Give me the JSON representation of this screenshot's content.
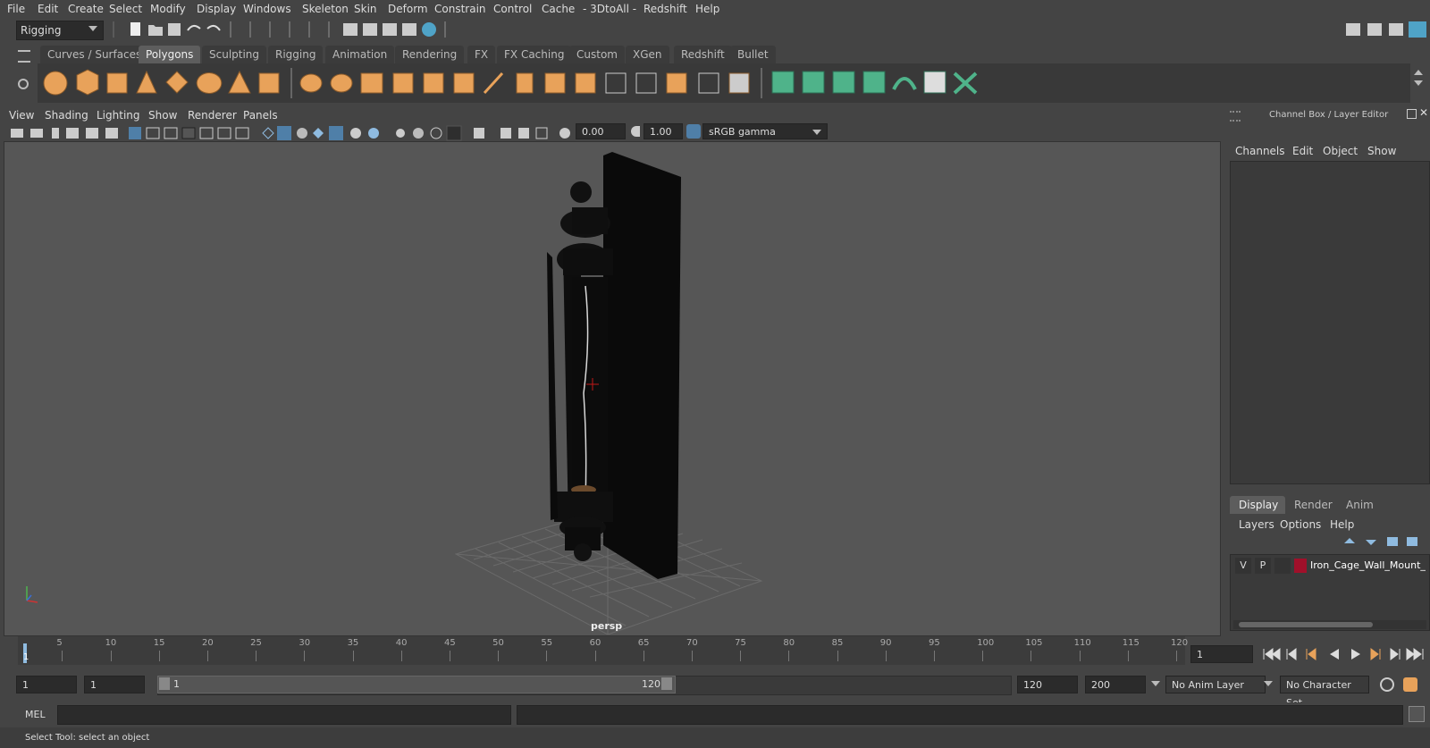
{
  "menubar": [
    "File",
    "Edit",
    "Create",
    "Select",
    "Modify",
    "Display",
    "Windows",
    "Skeleton",
    "Skin",
    "Deform",
    "Constrain",
    "Control",
    "Cache",
    "- 3DtoAll -",
    "Redshift",
    "Help"
  ],
  "status": {
    "mode": "Rigging"
  },
  "shelf_tabs": [
    "Curves / Surfaces",
    "Polygons",
    "Sculpting",
    "Rigging",
    "Animation",
    "Rendering",
    "FX",
    "FX Caching",
    "Custom",
    "XGen",
    "Redshift",
    "Bullet"
  ],
  "shelf_active": "Polygons",
  "viewport": {
    "menu": [
      "View",
      "Shading",
      "Lighting",
      "Show",
      "Renderer",
      "Panels"
    ],
    "exposure": "0.00",
    "gamma": "1.00",
    "color_space": "sRGB gamma",
    "camera_label": "persp"
  },
  "channel_box": {
    "title": "Channel Box / Layer Editor",
    "menu": [
      "Channels",
      "Edit",
      "Object",
      "Show"
    ]
  },
  "layer_editor": {
    "tabs": [
      "Display",
      "Render",
      "Anim"
    ],
    "active_tab": "Display",
    "menu": [
      "Layers",
      "Options",
      "Help"
    ],
    "layer": {
      "v": "V",
      "p": "P",
      "name": "Iron_Cage_Wall_Mount_",
      "color": "#a0102a"
    }
  },
  "timeline": {
    "ticks": [
      "5",
      "10",
      "15",
      "20",
      "25",
      "30",
      "35",
      "40",
      "45",
      "50",
      "55",
      "60",
      "65",
      "70",
      "75",
      "80",
      "85",
      "90",
      "95",
      "100",
      "105",
      "110",
      "115",
      "120"
    ],
    "current_marker": "1",
    "current_frame": "1"
  },
  "range": {
    "start": "1",
    "playback_start": "1",
    "slider_start": "1",
    "slider_end": "120",
    "playback_end": "120",
    "end": "200",
    "anim_layer": "No Anim Layer",
    "character_set": "No Character Set"
  },
  "command_line": {
    "label": "MEL"
  },
  "help_line": "Select Tool: select an object",
  "colors": {
    "accent": "#4fa3c7",
    "shelf_orange": "#e8a25a",
    "shelf_green": "#4fb38a"
  }
}
